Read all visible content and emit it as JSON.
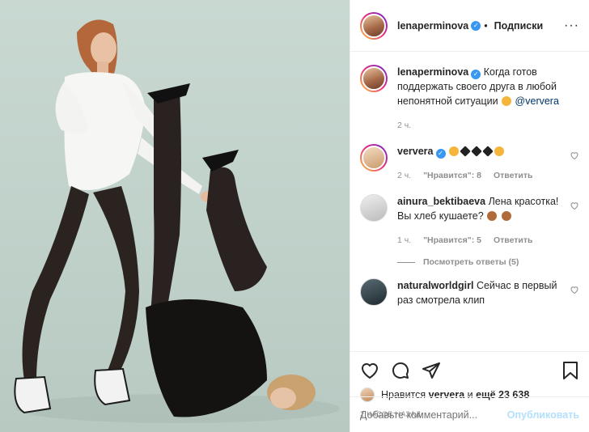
{
  "header": {
    "username": "lenaperminova",
    "separator": "•",
    "follow_label": "Подписки",
    "more_label": "···"
  },
  "caption": {
    "username": "lenaperminova",
    "text": "Когда готов поддержать своего друга в любой непонятной ситуации",
    "mention": "@ververa",
    "time": "2 ч."
  },
  "comments": [
    {
      "username": "ververa",
      "verified": true,
      "text": "",
      "time": "2 ч.",
      "likes": "\"Нравится\": 8",
      "reply": "Ответить"
    },
    {
      "username": "ainura_bektibaeva",
      "verified": false,
      "text": "Лена красотка! Вы хлеб кушаете?",
      "time": "1 ч.",
      "likes": "\"Нравится\": 5",
      "reply": "Ответить"
    },
    {
      "username": "naturalworldgirl",
      "verified": false,
      "text": "Сейчас в первый раз смотрела клип"
    }
  ],
  "view_replies": "Посмотреть ответы (5)",
  "likes": {
    "prefix": "Нравится",
    "user": "ververa",
    "middle": "и",
    "rest": "ещё 23 638"
  },
  "timestamp": "2 ЧАСОВ НАЗАД",
  "add_comment": {
    "placeholder": "Добавьте комментарий...",
    "publish_label": "Опубликовать"
  },
  "colors": {
    "verified": "#3897f0",
    "background_photo": "#c9d9d2",
    "publish_disabled": "#b2dffc",
    "meta": "#8e8e8e"
  }
}
